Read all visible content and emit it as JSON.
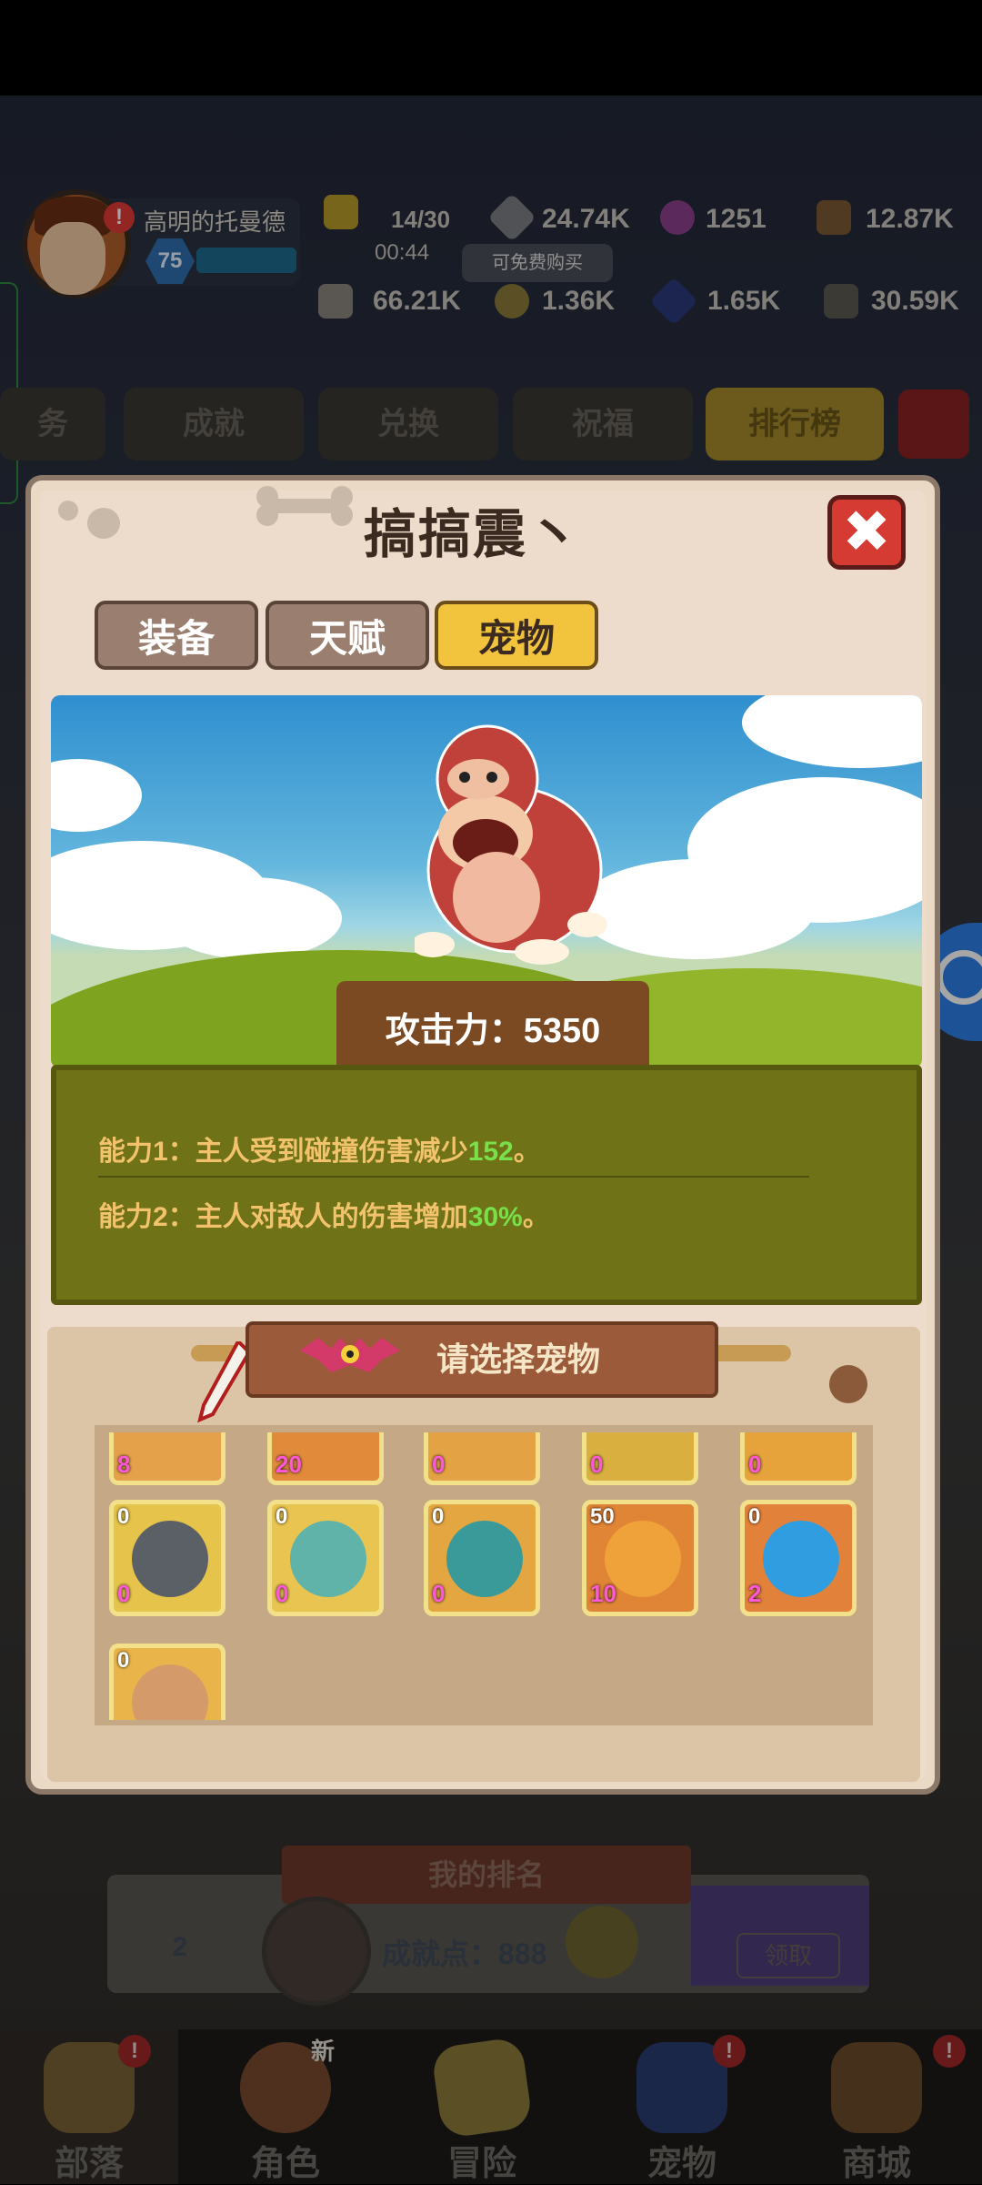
{
  "hud": {
    "player_name": "高明的托曼德",
    "level": "75",
    "energy": "14/30",
    "energy_timer": "00:44",
    "tooltip": "可免费购买",
    "resources": [
      {
        "icon": "gem-icon",
        "value": "24.74K"
      },
      {
        "icon": "orb-icon",
        "value": "1251"
      },
      {
        "icon": "wood-icon",
        "value": "12.87K"
      },
      {
        "icon": "bone-icon",
        "value": "66.21K"
      },
      {
        "icon": "gold-icon",
        "value": "1.36K"
      },
      {
        "icon": "crystal-icon",
        "value": "1.65K"
      },
      {
        "icon": "ore-icon",
        "value": "30.59K"
      }
    ]
  },
  "bg_tabs": [
    "务",
    "成就",
    "兑换",
    "祝福",
    "排行榜"
  ],
  "dialog": {
    "title": "搞搞震丶",
    "tabs": [
      "装备",
      "天赋",
      "宠物"
    ],
    "active_tab": "宠物",
    "attack_label": "攻击力：5350",
    "abilities": [
      {
        "prefix": "能力1：主人受到碰撞伤害减少",
        "value": "152",
        "suffix": "。"
      },
      {
        "prefix": "能力2：主人对敌人的伤害增加",
        "value": "30%",
        "suffix": "。"
      }
    ],
    "select_banner": "请选择宠物",
    "pets_row0": [
      {
        "bottom": "8"
      },
      {
        "bottom": "20"
      },
      {
        "bottom": "0"
      },
      {
        "bottom": "0"
      },
      {
        "bottom": "0"
      }
    ],
    "pets_row1": [
      {
        "top": "0",
        "bottom": "0",
        "name": "gray-cat-pet"
      },
      {
        "top": "0",
        "bottom": "0",
        "name": "goblin-top-hat-pet"
      },
      {
        "top": "0",
        "bottom": "0",
        "name": "crowned-dino-pet"
      },
      {
        "top": "50",
        "bottom": "10",
        "name": "orange-dragon-pet"
      },
      {
        "top": "0",
        "bottom": "2",
        "name": "blue-snail-pet"
      }
    ],
    "pets_row2": [
      {
        "top": "0",
        "name": "horse-pet"
      }
    ]
  },
  "rank": {
    "title": "我的排名",
    "position": "2",
    "points_label": "成就点：888",
    "receive_label": "领取"
  },
  "nav": [
    {
      "label": "部落",
      "badge": "!"
    },
    {
      "label": "角色",
      "badge": "新"
    },
    {
      "label": "冒险",
      "badge": ""
    },
    {
      "label": "宠物",
      "badge": "!"
    },
    {
      "label": "商城",
      "badge": "!"
    }
  ],
  "colors": {
    "accent_tab": "#f2c33c",
    "close_red": "#d63b33",
    "ability_text": "#f2c36c",
    "ability_value": "#7ae04a",
    "pet_count": "#ff58d7"
  }
}
